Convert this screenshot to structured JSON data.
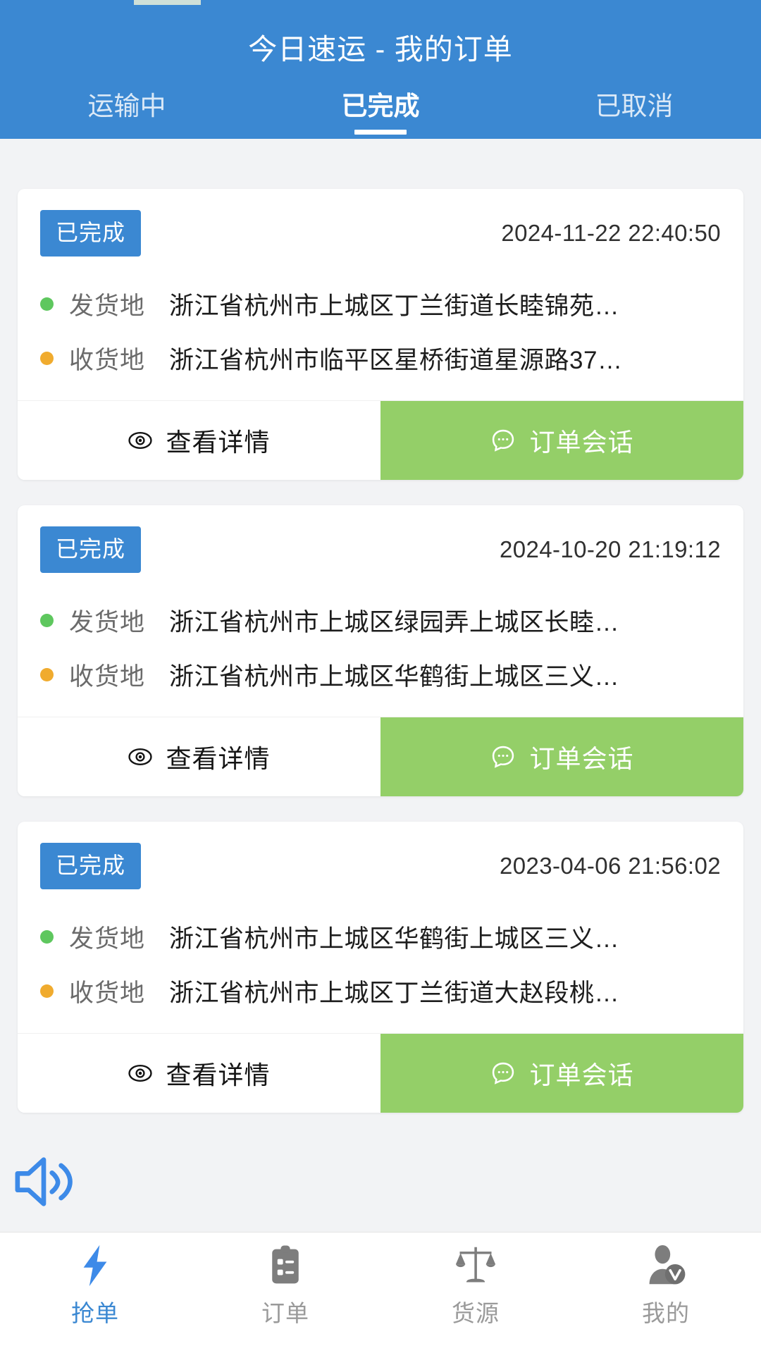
{
  "header": {
    "title": "今日速运 - 我的订单",
    "brand_color": "#3b88d2",
    "tabs": [
      {
        "label": "运输中",
        "active": false
      },
      {
        "label": "已完成",
        "active": true
      },
      {
        "label": "已取消",
        "active": false
      }
    ]
  },
  "orders": [
    {
      "status": "已完成",
      "time": "2024-11-22 22:40:50",
      "origin_label": "发货地",
      "origin_value": "浙江省杭州市上城区丁兰街道长睦锦苑…",
      "dest_label": "收货地",
      "dest_value": "浙江省杭州市临平区星桥街道星源路37…",
      "detail_btn": "查看详情",
      "chat_btn": "订单会话"
    },
    {
      "status": "已完成",
      "time": "2024-10-20 21:19:12",
      "origin_label": "发货地",
      "origin_value": "浙江省杭州市上城区绿园弄上城区长睦…",
      "dest_label": "收货地",
      "dest_value": "浙江省杭州市上城区华鹤街上城区三义…",
      "detail_btn": "查看详情",
      "chat_btn": "订单会话"
    },
    {
      "status": "已完成",
      "time": "2023-04-06 21:56:02",
      "origin_label": "发货地",
      "origin_value": "浙江省杭州市上城区华鹤街上城区三义…",
      "dest_label": "收货地",
      "dest_value": "浙江省杭州市上城区丁兰街道大赵段桃…",
      "detail_btn": "查看详情",
      "chat_btn": "订单会话"
    }
  ],
  "floating": {
    "speaker_icon": "volume-speaker-icon",
    "color": "#3d8ae8"
  },
  "bottom_nav": {
    "items": [
      {
        "label": "抢单",
        "icon": "lightning-bolt-icon",
        "active": true
      },
      {
        "label": "订单",
        "icon": "clipboard-checklist-icon",
        "active": false
      },
      {
        "label": "货源",
        "icon": "balance-scale-icon",
        "active": false
      },
      {
        "label": "我的",
        "icon": "user-profile-icon",
        "active": false
      }
    ],
    "active_color": "#3b88d2",
    "inactive_color": "#9a9a9a"
  },
  "colors": {
    "status_badge_bg": "#3b88d2",
    "chat_button_bg": "#94cf68",
    "origin_dot": "#5ec75e",
    "dest_dot": "#f0ab2e",
    "page_bg": "#f2f3f5"
  }
}
